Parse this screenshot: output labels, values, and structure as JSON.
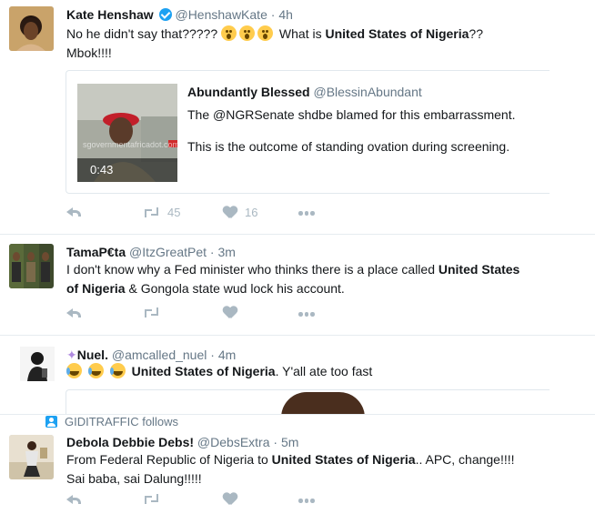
{
  "tweets": [
    {
      "name": "Kate Henshaw",
      "handle": "@HenshawKate",
      "time": "4h",
      "text_pre": "No he didn't say that?????",
      "text_mid": "What is ",
      "bold": "United States of Nigeria",
      "text_post": "??",
      "text_line2": "Mbok!!!!",
      "quote": {
        "name": "Abundantly Blessed",
        "handle": "@BlessinAbundant",
        "line1": "The @NGRSenate shdbe blamed for this embarrassment.",
        "line2": "This is the outcome of standing ovation during screening.",
        "video_duration": "0:43",
        "watermark": "sgovernmentafricadot.com"
      },
      "retweets": "45",
      "likes": "16"
    },
    {
      "name": "TamaP€ta",
      "handle": "@ItzGreatPet",
      "time": "3m",
      "text_pre": "I don't know why a Fed minister who thinks there is a place called ",
      "bold1": "United States",
      "bold2": "of Nigeria",
      "text_post": " & Gongola state wud lock his account."
    },
    {
      "name": "Nuel.",
      "handle": "@amcalled_nuel",
      "time": "4m",
      "bold": "United States of Nigeria",
      "text_post": ". Y'all ate too fast"
    },
    {
      "follows": "GIDITRAFFIC follows",
      "name": "Debola Debbie Debs!",
      "handle": "@DebsExtra",
      "time": "5m",
      "text_pre": "From Federal Republic of Nigeria to ",
      "bold": "United States of Nigeria",
      "text_post": ".. APC, change!!!!",
      "text_line2": "Sai baba, sai Dalung!!!!!"
    }
  ],
  "dot": "·"
}
